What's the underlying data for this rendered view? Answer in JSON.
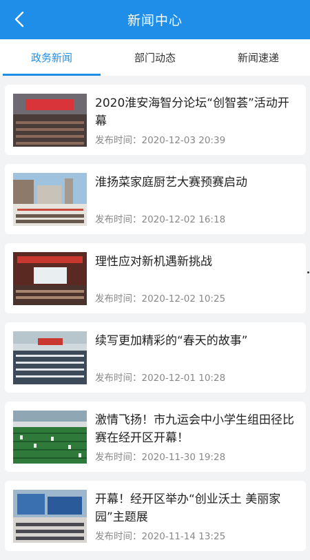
{
  "header": {
    "title": "新闻中心",
    "back_icon": "chevron-left-icon"
  },
  "tabs": [
    {
      "label": "政务新闻",
      "active": true
    },
    {
      "label": "部门动态",
      "active": false
    },
    {
      "label": "新闻速递",
      "active": false
    }
  ],
  "colors": {
    "accent": "#1e8ee8",
    "background": "#f2f3f5"
  },
  "news": [
    {
      "title": "2020淮安海智分论坛“创智荟”活动开幕",
      "date_label": "发布时间：",
      "date": "2020-12-03 20:39"
    },
    {
      "title": "淮扬菜家庭厨艺大赛预赛启动",
      "date_label": "发布时间：",
      "date": "2020-12-02 16:18"
    },
    {
      "title": "理性应对新机遇新挑战",
      "date_label": "发布时间：",
      "date": "2020-12-02 10:25"
    },
    {
      "title": "续写更加精彩的“春天的故事”",
      "date_label": "发布时间：",
      "date": "2020-12-01 10:28"
    },
    {
      "title": "激情飞扬！市九运会中小学生组田径比赛在经开区开幕！",
      "date_label": "发布时间：",
      "date": "2020-11-30 19:28"
    },
    {
      "title": "开幕！经开区举办“创业沃土 美丽家园”主题展",
      "date_label": "发布时间：",
      "date": "2020-11-14 13:25"
    }
  ]
}
